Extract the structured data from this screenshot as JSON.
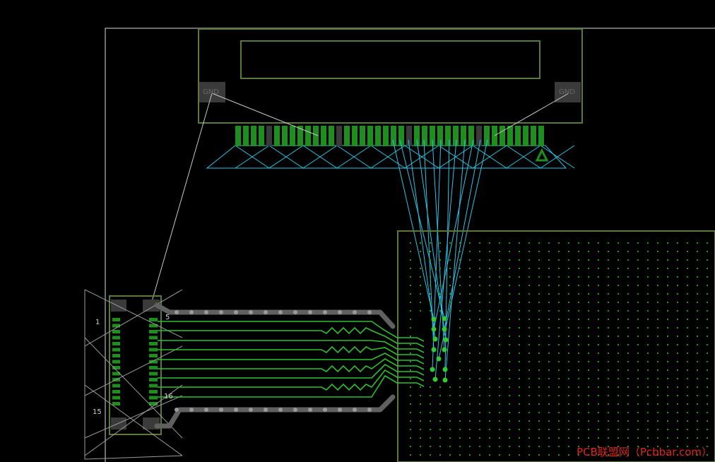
{
  "board": {
    "background": "#000000",
    "outline_color": "#d8d8d8",
    "silk_color": "#5a7a3c",
    "copper_pad_color": "#1e8f1e",
    "airwire_color": "#26c6e8",
    "ratsnest_gray": "#c8c8c8",
    "trace_color": "#2fbf2f",
    "gnd_trace_color": "#606060"
  },
  "lcd": {
    "left_pad_label": "GND",
    "right_pad_label": "GND",
    "pin1_marker": "4"
  },
  "connector": {
    "pin_top_right": "5",
    "pin_bottom_right": "16",
    "pin_top_left": "1",
    "pin_bottom_left": "15"
  },
  "watermark": "PCB联盟网（Pcbbar.com）",
  "icons": {
    "pin1": "triangle-marker-icon"
  }
}
